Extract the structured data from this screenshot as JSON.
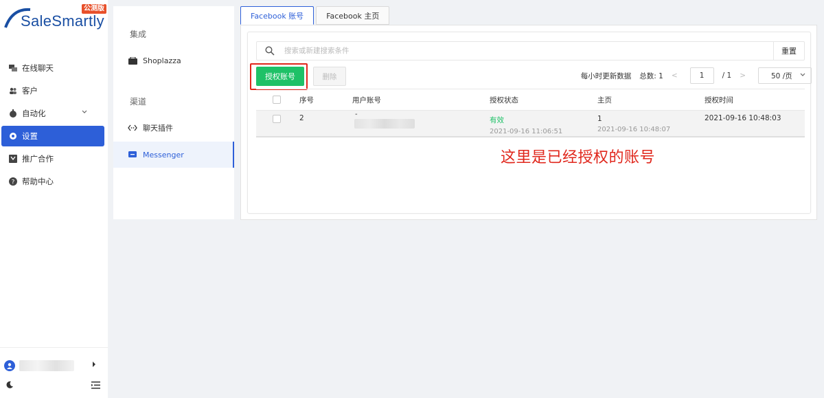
{
  "brand": {
    "name": "SaleSmartly",
    "badge": "公测版"
  },
  "sidebar": {
    "items": [
      {
        "label": "在线聊天",
        "icon": "chat-icon"
      },
      {
        "label": "客户",
        "icon": "users-icon"
      },
      {
        "label": "自动化",
        "icon": "automation-icon"
      },
      {
        "label": "设置",
        "icon": "settings-icon"
      },
      {
        "label": "推广合作",
        "icon": "promotion-icon"
      },
      {
        "label": "帮助中心",
        "icon": "help-icon"
      }
    ]
  },
  "settings_nav": {
    "section1": "集成",
    "shoplazza": "Shoplazza",
    "section2": "渠道",
    "chat_plugin": "聊天插件",
    "messenger": "Messenger"
  },
  "tabs": {
    "account": "Facebook 账号",
    "homepage": "Facebook 主页"
  },
  "search": {
    "placeholder": "搜索或新建搜索条件",
    "reset": "重置"
  },
  "toolbar": {
    "authorize": "授权账号",
    "delete": "删除"
  },
  "pager": {
    "refresh_note": "每小时更新数据",
    "total_label": "总数: 1",
    "prev": "<",
    "page": "1",
    "of": "/ 1",
    "next": ">",
    "page_size": "50 /页"
  },
  "table": {
    "headers": {
      "index": "序号",
      "account": "用户账号",
      "status": "授权状态",
      "homepage": "主页",
      "auth_time": "授权时间"
    },
    "rows": [
      {
        "index": "2",
        "account_prefix": "-",
        "status": "有效",
        "status_time": "2021-09-16 11:06:51",
        "homepage": "1",
        "homepage_time": "2021-09-16 10:48:07",
        "auth_time": "2021-09-16 10:48:03"
      }
    ]
  },
  "annotation": "这里是已经授权的账号",
  "colors": {
    "primary": "#2d5fd8",
    "success": "#1ec167",
    "highlight": "#e0261b",
    "logo": "#1a4fa3"
  }
}
